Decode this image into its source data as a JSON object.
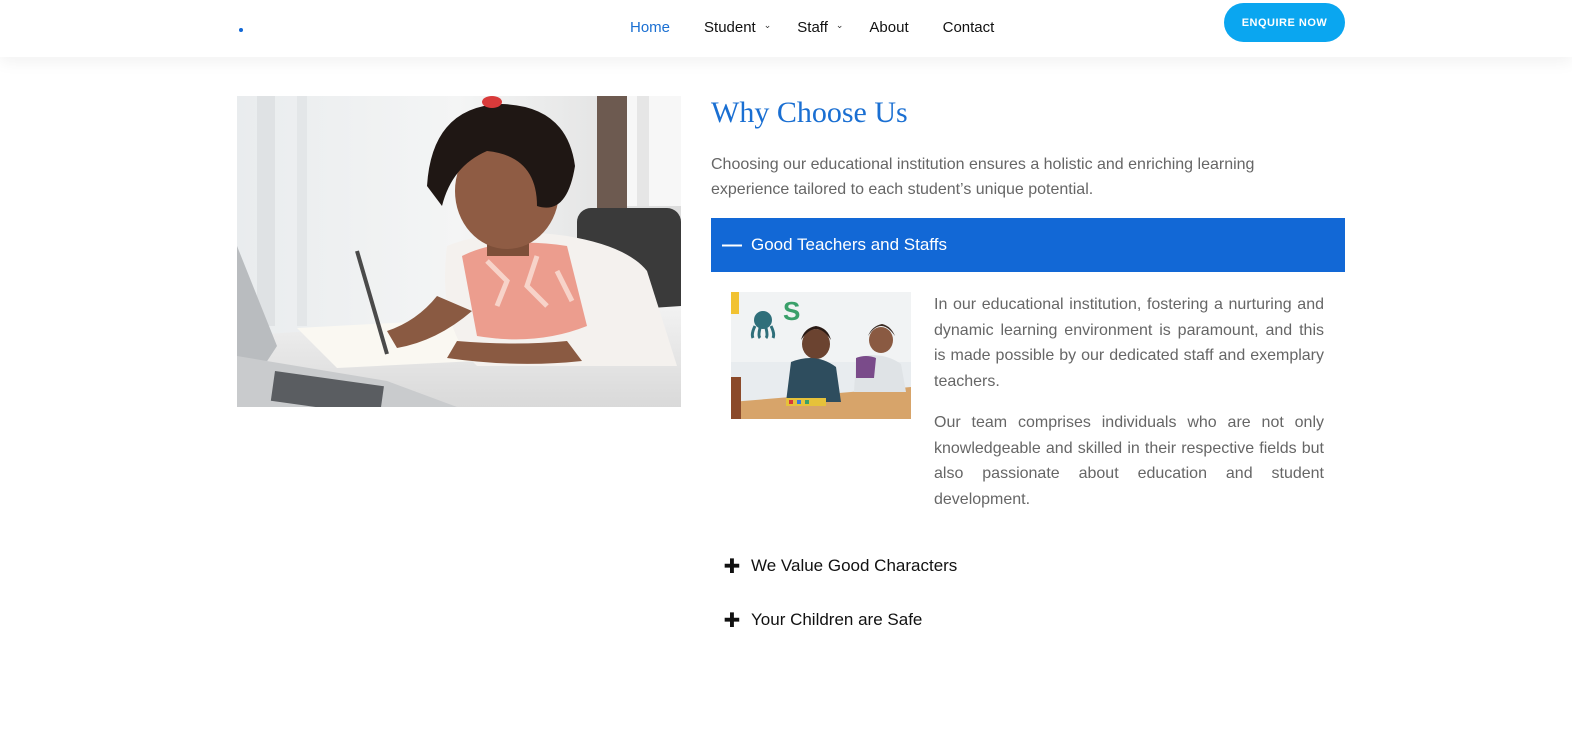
{
  "nav": {
    "items": [
      {
        "label": "Home",
        "active": true,
        "has_submenu": false
      },
      {
        "label": "Student",
        "active": false,
        "has_submenu": true
      },
      {
        "label": "Staff",
        "active": false,
        "has_submenu": true
      },
      {
        "label": "About",
        "active": false,
        "has_submenu": false
      },
      {
        "label": "Contact",
        "active": false,
        "has_submenu": false
      }
    ],
    "submenu_icon": "chevron-down-icon",
    "cta_label": "ENQUIRE NOW"
  },
  "section": {
    "title": "Why Choose Us",
    "intro": "Choosing our educational institution ensures a holistic and enriching learning experience tailored to each student’s unique potential."
  },
  "accordion": [
    {
      "label": "Good Teachers and Staffs",
      "open": true,
      "icon": "minus-icon",
      "paragraphs": [
        "In our educational institution, fostering a nurturing and dynamic learning environment is paramount, and this is made possible by our dedicated staff and exemplary teachers.",
        "Our team comprises individuals who are not only knowledgeable and skilled in their respective fields but also passionate about education and student development."
      ]
    },
    {
      "label": "We Value Good Characters",
      "open": false,
      "icon": "plus-icon"
    },
    {
      "label": "Your Children are Safe",
      "open": false,
      "icon": "plus-icon"
    }
  ],
  "colors": {
    "accent": "#1268d6",
    "nav_active": "#1a6fd2",
    "cta": "#0aa6f0",
    "body_text": "#666666"
  }
}
